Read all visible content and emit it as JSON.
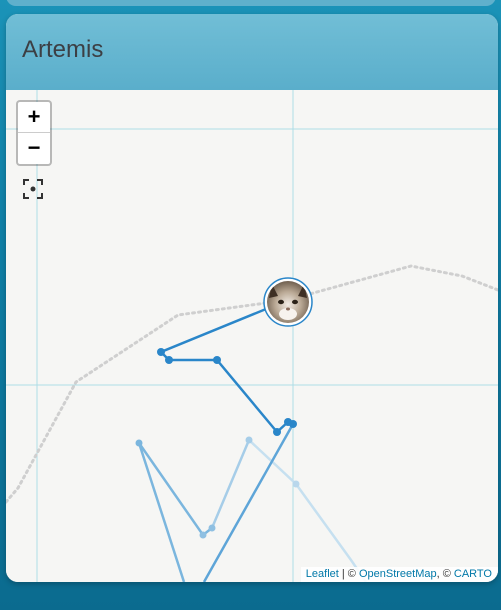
{
  "card": {
    "title": "Artemis"
  },
  "map": {
    "zoom_in_label": "+",
    "zoom_out_label": "−",
    "attribution": {
      "leaflet": "Leaflet",
      "separator1": " | © ",
      "osm": "OpenStreetMap",
      "separator2": ", © ",
      "carto": "CARTO"
    },
    "track_color": "#2a86c9",
    "grid_color": "#aedde6"
  }
}
